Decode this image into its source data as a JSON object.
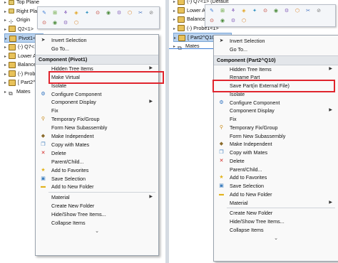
{
  "left": {
    "tree": [
      {
        "label": "Top Plane",
        "icon": "plane-icon"
      },
      {
        "label": "Right Pla",
        "icon": "plane-icon"
      },
      {
        "label": "Origin",
        "icon": "origin-icon"
      },
      {
        "label": "Q2<1>",
        "icon": "part-icon"
      },
      {
        "label": "Pivot1<1",
        "icon": "part-icon"
      },
      {
        "label": "(-) Q7<1>",
        "icon": "part-icon"
      },
      {
        "label": "Lower A",
        "icon": "part-icon"
      },
      {
        "label": "Balance1",
        "icon": "part-icon"
      },
      {
        "label": "(-) Probe1",
        "icon": "part-icon"
      },
      {
        "label": "[ Part2^",
        "icon": "part-icon"
      },
      {
        "label": "Mates",
        "icon": "mates-icon"
      }
    ],
    "menu": {
      "items_top": [
        {
          "label": "Invert Selection",
          "icon": "cursor-icon"
        },
        {
          "label": "Go To...",
          "icon": ""
        }
      ],
      "header": "Component (Pivot1)",
      "items": [
        {
          "label": "Hidden Tree Items",
          "icon": "",
          "submenu": true
        },
        {
          "label": "Make Virtual",
          "icon": "",
          "highlight": true
        },
        {
          "label": "Isolate",
          "icon": ""
        },
        {
          "label": "Configure Component",
          "icon": "configure-icon"
        },
        {
          "label": "Component Display",
          "icon": "",
          "submenu": true
        },
        {
          "label": "Fix",
          "icon": ""
        },
        {
          "label": "Temporary Fix/Group",
          "icon": "pin-icon"
        },
        {
          "label": "Form New Subassembly",
          "icon": ""
        },
        {
          "label": "Make Independent",
          "icon": "independent-icon"
        },
        {
          "label": "Copy with Mates",
          "icon": "copy-mates-icon"
        },
        {
          "label": "Delete",
          "icon": "delete-icon"
        },
        {
          "label": "Parent/Child...",
          "icon": ""
        },
        {
          "label": "Add to Favorites",
          "icon": "star-icon"
        },
        {
          "label": "Save Selection",
          "icon": "save-selection-icon"
        },
        {
          "label": "Add to New Folder",
          "icon": "folder-icon"
        },
        {
          "label": "Material",
          "icon": "",
          "submenu": true
        },
        {
          "label": "Create New Folder",
          "icon": ""
        },
        {
          "label": "Hide/Show Tree Items...",
          "icon": ""
        },
        {
          "label": "Collapse Items",
          "icon": ""
        }
      ],
      "more": "⌄"
    }
  },
  "right": {
    "tree": [
      {
        "label": "(-) Q7<1> (Default",
        "icon": "part-icon"
      },
      {
        "label": "Lower Arm1<1>",
        "icon": "part-icon"
      },
      {
        "label": "Balance1<1>",
        "icon": "part-icon"
      },
      {
        "label": "(-) Probe1<1>",
        "icon": "part-icon"
      },
      {
        "label": "[ Part2^Q10 ]<1>",
        "icon": "part-icon"
      },
      {
        "label": "Mates",
        "icon": "mates-icon"
      }
    ],
    "menu": {
      "items_top": [
        {
          "label": "Invert Selection",
          "icon": "cursor-icon"
        },
        {
          "label": "Go To...",
          "icon": ""
        }
      ],
      "header": "Component (Part2^Q10)",
      "items": [
        {
          "label": "Hidden Tree Items",
          "icon": "",
          "submenu": true
        },
        {
          "label": "Rename Part",
          "icon": ""
        },
        {
          "label": "Save Part(in External File)",
          "icon": "",
          "highlight": true
        },
        {
          "label": "Isolate",
          "icon": ""
        },
        {
          "label": "Configure Component",
          "icon": "configure-icon"
        },
        {
          "label": "Component Display",
          "icon": "",
          "submenu": true
        },
        {
          "label": "Fix",
          "icon": ""
        },
        {
          "label": "Temporary Fix/Group",
          "icon": "pin-icon"
        },
        {
          "label": "Form New Subassembly",
          "icon": ""
        },
        {
          "label": "Make Independent",
          "icon": "independent-icon"
        },
        {
          "label": "Copy with Mates",
          "icon": "copy-mates-icon"
        },
        {
          "label": "Delete",
          "icon": "delete-icon"
        },
        {
          "label": "Parent/Child...",
          "icon": ""
        },
        {
          "label": "Add to Favorites",
          "icon": "star-icon"
        },
        {
          "label": "Save Selection",
          "icon": "save-selection-icon"
        },
        {
          "label": "Add to New Folder",
          "icon": "folder-icon"
        },
        {
          "label": "Material",
          "icon": "",
          "submenu": true
        },
        {
          "label": "Create New Folder",
          "icon": ""
        },
        {
          "label": "Hide/Show Tree Items...",
          "icon": ""
        },
        {
          "label": "Collapse Items",
          "icon": ""
        }
      ],
      "more": "⌄"
    }
  },
  "colors": {
    "highlight_box": "#e0242d",
    "menu_bg": "#f9f9f9",
    "header_bg": "#e3e6ea",
    "selected_row": "#b9d2ee"
  }
}
